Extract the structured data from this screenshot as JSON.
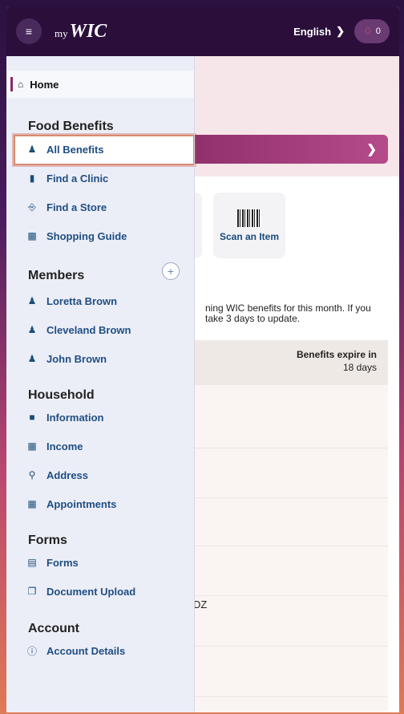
{
  "header": {
    "menu_icon": "hamburger-icon",
    "logo_prefix": "my",
    "logo_main": "WIC",
    "language": "English",
    "notifications_count": "0",
    "colors": {
      "header_bg": "#2b0e3a",
      "accent": "#8a2a6a"
    }
  },
  "drawer": {
    "home": {
      "label": "Home",
      "icon": "home-icon"
    },
    "sections": {
      "food_benefits": "Food Benefits",
      "members": "Members",
      "household": "Household",
      "forms": "Forms",
      "account": "Account"
    },
    "food_items": [
      {
        "label": "All Benefits",
        "icon": "users-icon"
      },
      {
        "label": "Find a Clinic",
        "icon": "clinic-icon"
      },
      {
        "label": "Find a Store",
        "icon": "cart-icon"
      },
      {
        "label": "Shopping Guide",
        "icon": "book-icon"
      }
    ],
    "member_items": [
      {
        "label": "Loretta Brown",
        "icon": "person-icon"
      },
      {
        "label": "Cleveland Brown",
        "icon": "person-icon"
      },
      {
        "label": "John Brown",
        "icon": "person-icon"
      }
    ],
    "household_items": [
      {
        "label": "Information",
        "icon": "document-icon"
      },
      {
        "label": "Income",
        "icon": "calculator-icon"
      },
      {
        "label": "Address",
        "icon": "location-pin-icon"
      },
      {
        "label": "Appointments",
        "icon": "calendar-icon"
      }
    ],
    "forms_items": [
      {
        "label": "Forms",
        "icon": "form-icon"
      },
      {
        "label": "Document Upload",
        "icon": "upload-copy-icon"
      }
    ],
    "account_items": [
      {
        "label": "Account Details",
        "icon": "info-icon"
      }
    ]
  },
  "main": {
    "scan_tile": "Scan an Item",
    "info_line1": "ning WIC benefits for this month. If you",
    "info_line2": "take 3 days to update.",
    "expire_title": "Benefits expire in",
    "expire_days": "18 days",
    "partial_text": "DZ"
  }
}
